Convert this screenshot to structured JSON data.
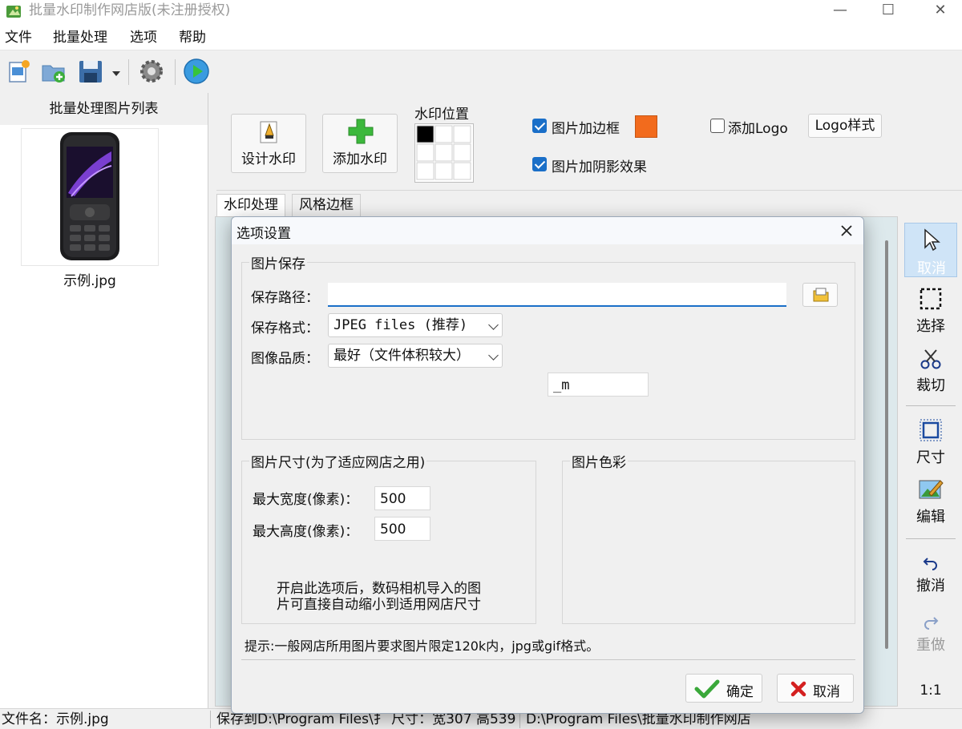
{
  "window": {
    "title": "批量水印制作网店版(未注册授权)",
    "minimize": "—",
    "maximize": "☐",
    "close": "✕"
  },
  "menu": [
    "文件",
    "批量处理",
    "选项",
    "帮助"
  ],
  "left_panel": {
    "header": "批量处理图片列表",
    "thumbnail_label": "示例.jpg"
  },
  "top_panel": {
    "design_watermark": "设计水印",
    "add_watermark": "添加水印",
    "watermark_position_label": "水印位置",
    "border_checkbox": {
      "label": "图片加边框",
      "checked": true
    },
    "border_color": "#f26b1d",
    "shadow_checkbox": {
      "label": "图片加阴影效果",
      "checked": true
    },
    "logo_checkbox": {
      "label": "添加Logo",
      "checked": false
    },
    "logo_style_button": "Logo样式"
  },
  "tabs": [
    "水印处理",
    "风格边框"
  ],
  "sidebar": {
    "cancel": "取消",
    "select": "选择",
    "crop": "裁切",
    "size": "尺寸",
    "edit": "编辑",
    "undo": "撤消",
    "redo": "重做",
    "zoom": "1:1"
  },
  "status": {
    "filename_label": "文件名：",
    "filename": "示例.jpg",
    "save_info": "保存到D:\\Program Files\\扌 尺寸：宽307 高539",
    "path": "D:\\Program Files\\批量水印制作网店"
  },
  "dialog": {
    "title": "选项设置",
    "save_group": {
      "title": "图片保存",
      "path_label": "保存路径：",
      "path_value": "",
      "format_label": "保存格式：",
      "format_value": "JPEG files (推荐)",
      "quality_label": "图像品质：",
      "quality_value": "最好（文件体积较大）",
      "suffix_value": "_m"
    },
    "size_group": {
      "title": "图片尺寸(为了适应网店之用)",
      "max_width_label": "最大宽度(像素)：",
      "max_width": "500",
      "max_height_label": "最大高度(像素)：",
      "max_height": "500",
      "note_line1": "开启此选项后，数码相机导入的图",
      "note_line2": "片可直接自动缩小到适用网店尺寸"
    },
    "color_group": {
      "title": "图片色彩"
    },
    "hint": "提示:一般网店所用图片要求图片限定120k内，jpg或gif格式。",
    "ok": "确定",
    "cancel": "取消"
  }
}
